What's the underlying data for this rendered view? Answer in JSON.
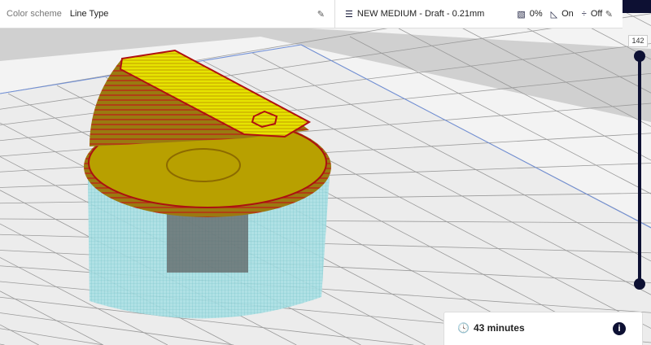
{
  "view": {
    "color_scheme_label": "Color scheme",
    "color_scheme_value": "Line Type"
  },
  "print_setup": {
    "profile": "NEW MEDIUM - Draft - 0.21mm",
    "infill": "0%",
    "support": "On",
    "adhesion": "Off"
  },
  "layer_slider": {
    "current_layer": "142",
    "max_fraction": 1.0
  },
  "estimate": {
    "time": "43 minutes"
  },
  "colors": {
    "accent": "#0d1033",
    "support": "#7fd3d9",
    "wall": "#b21f1f",
    "skin": "#e8e600"
  }
}
